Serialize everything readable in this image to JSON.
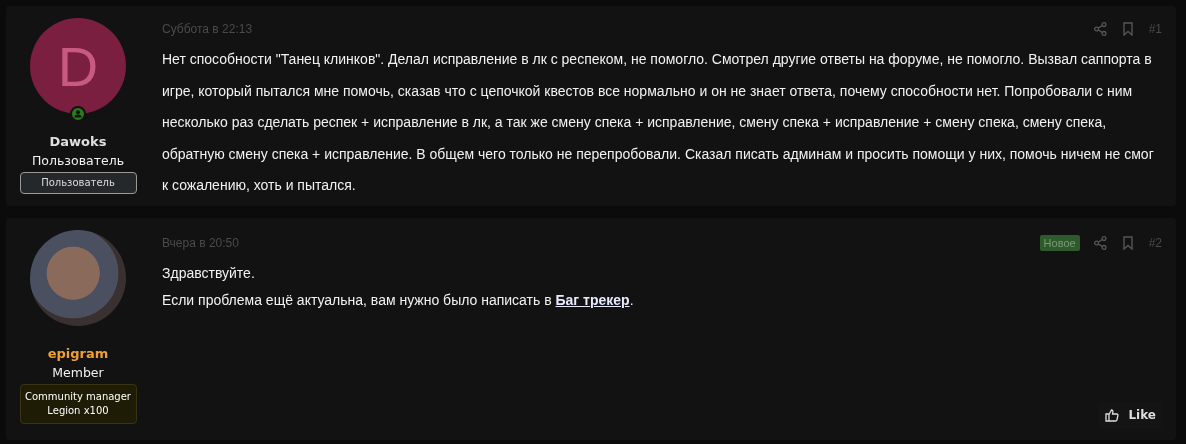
{
  "posts": [
    {
      "author": {
        "avatar": {
          "kind": "letter",
          "letter": "D"
        },
        "online": true,
        "name": "Dawoks",
        "color": "#e0e0e0",
        "title": "Пользователь",
        "banner": {
          "kind": "default",
          "lines": [
            "Пользователь"
          ]
        }
      },
      "date": "Суббота в 22:13",
      "is_new": false,
      "number": "#1",
      "paragraphs": [
        [
          {
            "kind": "text",
            "text": "Нет способности \"Танец клинков\". Делал исправление в лк с респеком, не помогло. Смотрел другие ответы на форуме, не помогло. Вызвал саппорта в игре, который пытался мне помочь, сказав что с цепочкой квестов все нормально и он не знает ответа, почему способности нет. Попробовали с ним несколько раз сделать респек + исправление в лк, а так же смену спека + исправление, смену спека + исправление + смену спека, смену спека, обратную смену спека + исправление. В общем чего только не перепробовали. Сказал писать админам и просить помощи у них, помочь ничем не смог к сожалению, хоть и пытался."
          }
        ]
      ]
    },
    {
      "author": {
        "avatar": {
          "kind": "photo"
        },
        "online": false,
        "name": "epigram",
        "color": "#f0a030",
        "title": "Member",
        "banner": {
          "kind": "staff",
          "lines": [
            "Community manager",
            "Legion x100"
          ]
        }
      },
      "date": "Вчера в 20:50",
      "is_new": true,
      "new_label": "Новое",
      "number": "#2",
      "paragraphs": [
        [
          {
            "kind": "text",
            "text": "Здравствуйте."
          }
        ],
        [
          {
            "kind": "text",
            "text": "Если проблема ещё актуальна, вам нужно было написать в "
          },
          {
            "kind": "link",
            "text": "Баг трекер"
          },
          {
            "kind": "text",
            "text": "."
          }
        ]
      ],
      "like": "Like"
    }
  ]
}
